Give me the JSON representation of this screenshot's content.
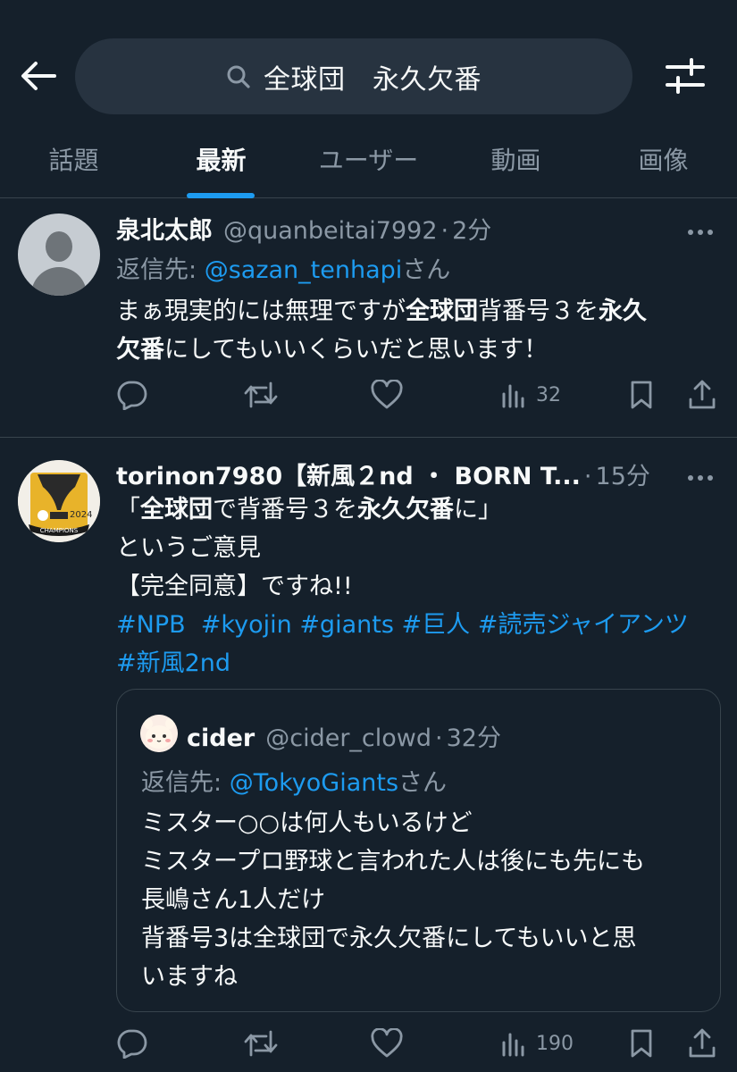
{
  "search": {
    "query": "全球団　永久欠番"
  },
  "tabs": [
    "話題",
    "最新",
    "ユーザー",
    "動画",
    "画像"
  ],
  "tweets": [
    {
      "display_name": "泉北太郎",
      "handle": "@quanbeitai7992",
      "time": "2分",
      "reply_prefix": "返信先:",
      "reply_mention": "@sazan_tenhapi",
      "reply_suffix": "さん",
      "text": {
        "l1a": "まぁ現実的には無理ですが",
        "l1b": "全球団",
        "l1c": "背番号３を",
        "l1d": "永久",
        "l2a": "欠番",
        "l2b": "にしてもいいくらいだと思います！"
      },
      "views": "32"
    },
    {
      "display_name": "torinon7980【新風２nd ・ BORN T...",
      "time": "15分",
      "text": {
        "l1a": "「",
        "l1b": "全球団",
        "l1c": "で背番号３を",
        "l1d": "永久欠番",
        "l1e": "に」",
        "l2": "というご意見",
        "l3": "【完全同意】ですね!!"
      },
      "hashtags": [
        "#NPB",
        "#kyojin",
        "#giants",
        "#巨人",
        "#読売ジャイアンツ",
        "#新風2nd"
      ],
      "avatar_label": "CHAMPIONS",
      "avatar_year": "2024",
      "views": "190",
      "quote": {
        "display_name": "cider",
        "handle": "@cider_clowd",
        "time": "32分",
        "reply_prefix": "返信先:",
        "reply_mention": "@TokyoGiants",
        "reply_suffix": "さん",
        "lines": [
          "ミスター○○は何人もいるけど",
          "ミスタープロ野球と言われた人は後にも先にも",
          "長嶋さん1人だけ",
          "背番号3は全球団で永久欠番にしてもいいと思",
          "いますね"
        ]
      }
    }
  ],
  "colors": {
    "background": "#15202b",
    "accent": "#1d9bf0",
    "muted": "#8b98a5",
    "text": "#f7f9f9",
    "divider": "#38444d"
  },
  "icons": [
    "back-arrow-icon",
    "search-icon",
    "filter-icon",
    "more-icon",
    "reply-icon",
    "retweet-icon",
    "like-icon",
    "views-icon",
    "bookmark-icon",
    "share-icon"
  ]
}
